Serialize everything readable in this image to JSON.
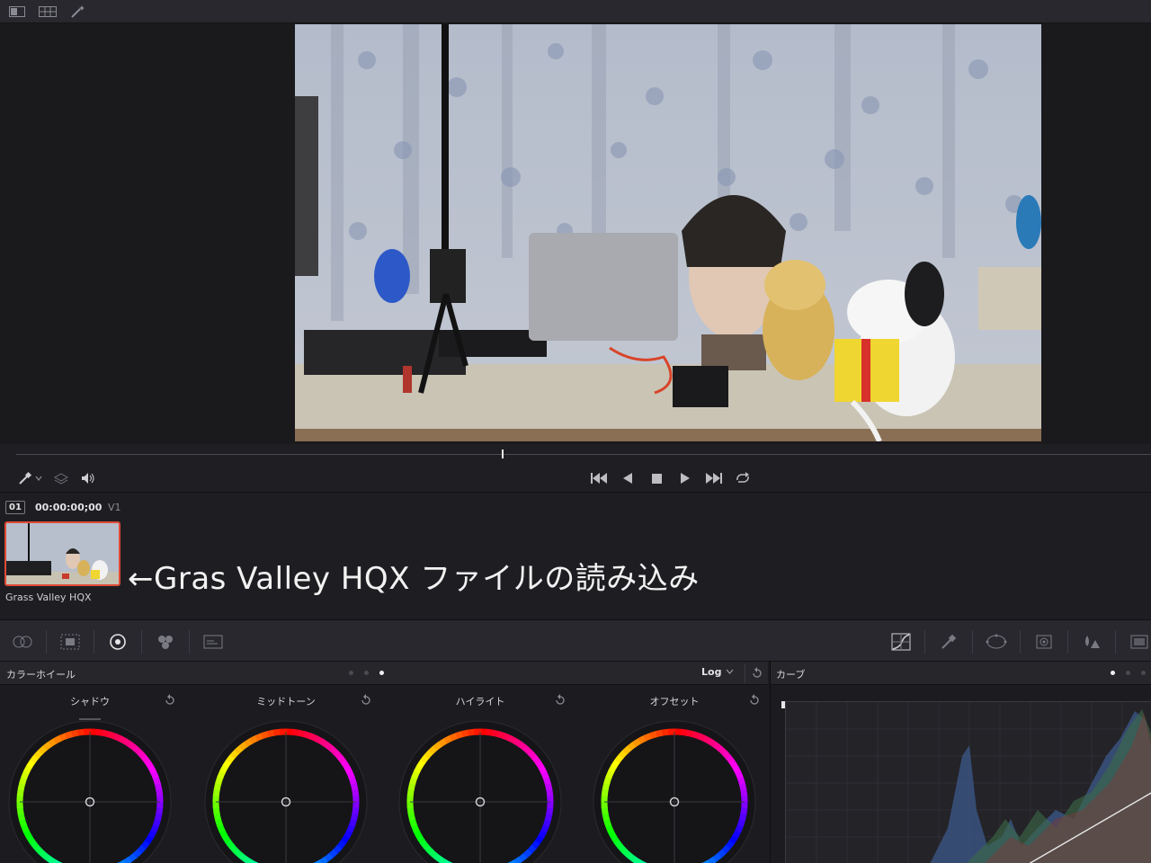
{
  "topbar": {
    "icons": [
      "single-viewer-icon",
      "split-viewer-icon",
      "magic-wand-icon"
    ]
  },
  "viewer": {
    "image": "desk-scene-with-mannequin-head-and-plush-toys"
  },
  "transport": {
    "left_icons": [
      "eyedropper-icon",
      "chevron-down-icon",
      "layers-icon",
      "speaker-icon"
    ],
    "controls": [
      "skip-to-start-icon",
      "play-reverse-icon",
      "stop-icon",
      "play-icon",
      "skip-to-end-icon",
      "loop-icon"
    ]
  },
  "clips": {
    "number": "01",
    "timecode": "00:00:00;00",
    "track": "V1",
    "name": "Grass Valley HQX",
    "annotation": "←Gras Valley HQX ファイルの読み込み"
  },
  "color_toolbar": {
    "left_icons": [
      "camera-raw-icon",
      "color-match-icon",
      "color-wheels-icon",
      "rgb-mixer-icon",
      "motion-effects-icon"
    ],
    "right_icons": [
      "curves-icon",
      "qualifier-icon",
      "window-icon",
      "tracker-icon",
      "blur-icon",
      "key-icon"
    ]
  },
  "wheels_panel": {
    "title": "カラーホイール",
    "mode": "Log",
    "wheels": [
      {
        "label": "シャドウ"
      },
      {
        "label": "ミッドトーン"
      },
      {
        "label": "ハイライト"
      },
      {
        "label": "オフセット"
      }
    ]
  },
  "curves_panel": {
    "title": "カーブ"
  },
  "colors": {
    "accent_selection": "#e04a36",
    "panel_bg": "#1c1c20",
    "header_bg": "#26262b"
  }
}
